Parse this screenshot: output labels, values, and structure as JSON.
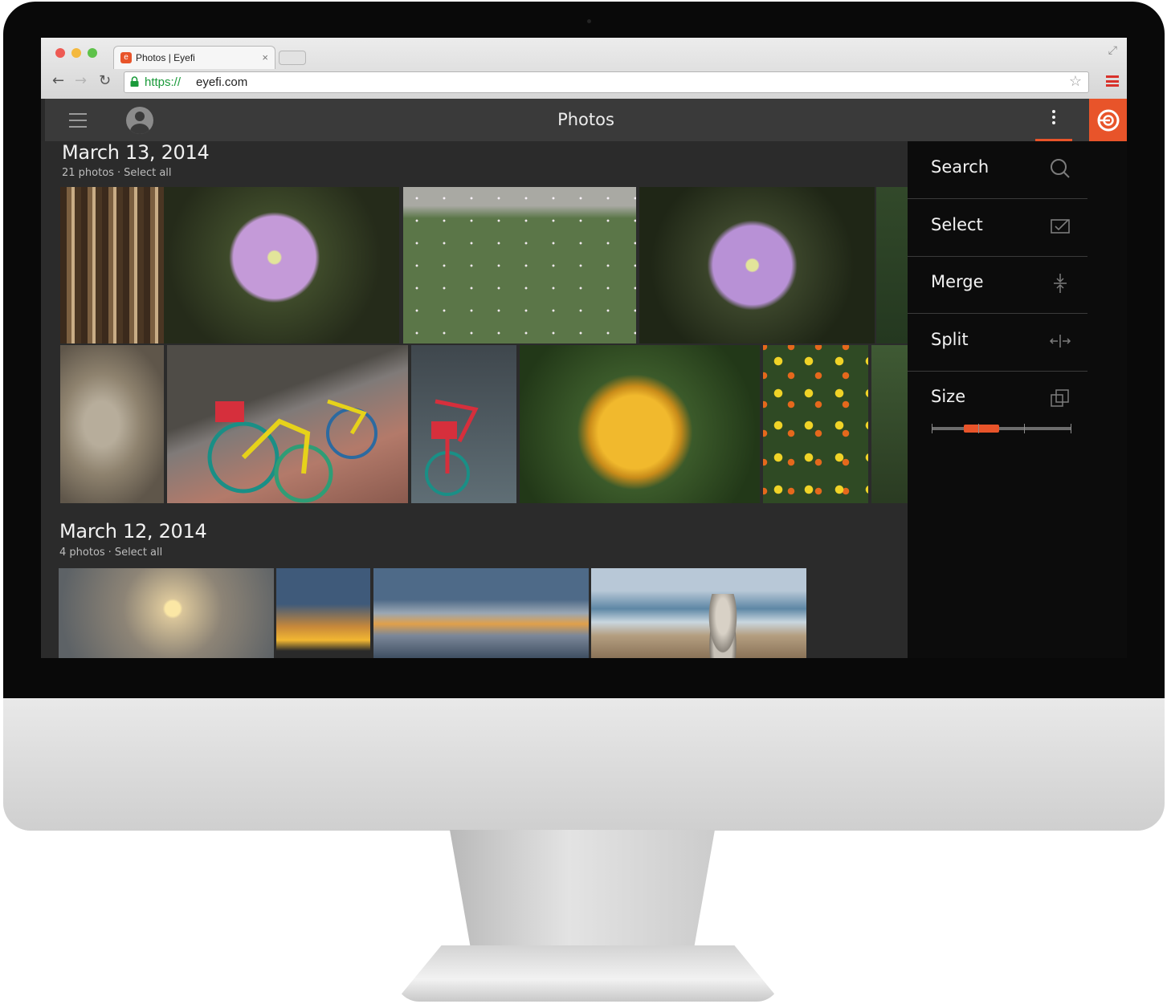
{
  "browser": {
    "tab_title": "Photos | Eyefi",
    "tab_close": "×",
    "url_scheme": "https://",
    "url_host": "eyefi.com"
  },
  "app": {
    "title": "Photos"
  },
  "groups": [
    {
      "date": "March 13, 2014",
      "count": "21 photos",
      "select_all": "Select all",
      "separator": "·"
    },
    {
      "date": "March 12, 2014",
      "count": "4 photos",
      "select_all": "Select all",
      "separator": "·"
    }
  ],
  "side_menu": {
    "items": [
      {
        "label": "Search",
        "icon": "search-icon"
      },
      {
        "label": "Select",
        "icon": "select-checkbox-icon"
      },
      {
        "label": "Merge",
        "icon": "merge-icon"
      },
      {
        "label": "Split",
        "icon": "split-icon"
      },
      {
        "label": "Size",
        "icon": "size-icon"
      }
    ],
    "size_slider": {
      "value_fraction": 0.31,
      "ticks": 4
    }
  },
  "colors": {
    "accent": "#e8542a",
    "header_bg": "#3a3a3a",
    "content_bg": "#2b2b2b",
    "menu_bg": "#0c0c0c"
  },
  "photos": {
    "group1": [
      "tree-bark",
      "purple-flower",
      "pink-wildflowers",
      "purple-flower",
      "foliage",
      "tree-trunk",
      "colorful-bicycles",
      "bicycles",
      "yellow-poppy",
      "orange-yellow-flowers",
      "foliage"
    ],
    "group2": [
      "sunset-sky",
      "sunset-clouds",
      "sunset-water",
      "beach-stones"
    ]
  }
}
